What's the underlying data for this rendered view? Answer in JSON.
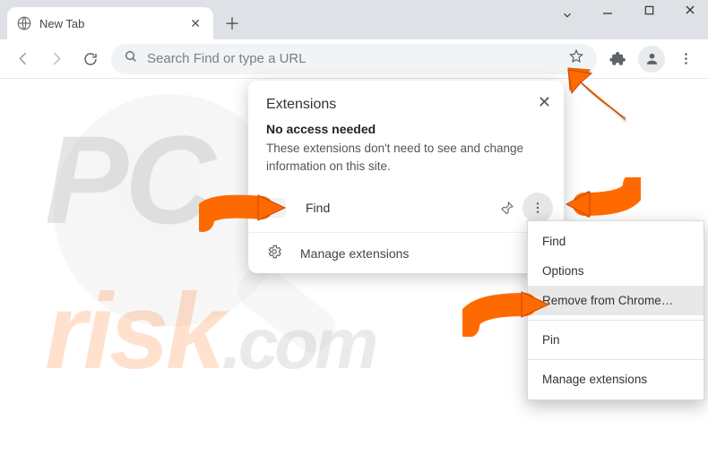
{
  "tab": {
    "title": "New Tab"
  },
  "omnibox": {
    "placeholder": "Search Find or type a URL"
  },
  "ext_popup": {
    "title": "Extensions",
    "subtitle": "No access needed",
    "description": "These extensions don't need to see and change information on this site.",
    "item_name": "Find",
    "manage_label": "Manage extensions"
  },
  "ctx": {
    "items": [
      "Find",
      "Options",
      "Remove from Chrome…",
      "Pin",
      "Manage extensions"
    ],
    "highlighted_index": 2
  },
  "watermark": {
    "text1": "PC",
    "text2": "risk",
    "text3": ".com"
  }
}
